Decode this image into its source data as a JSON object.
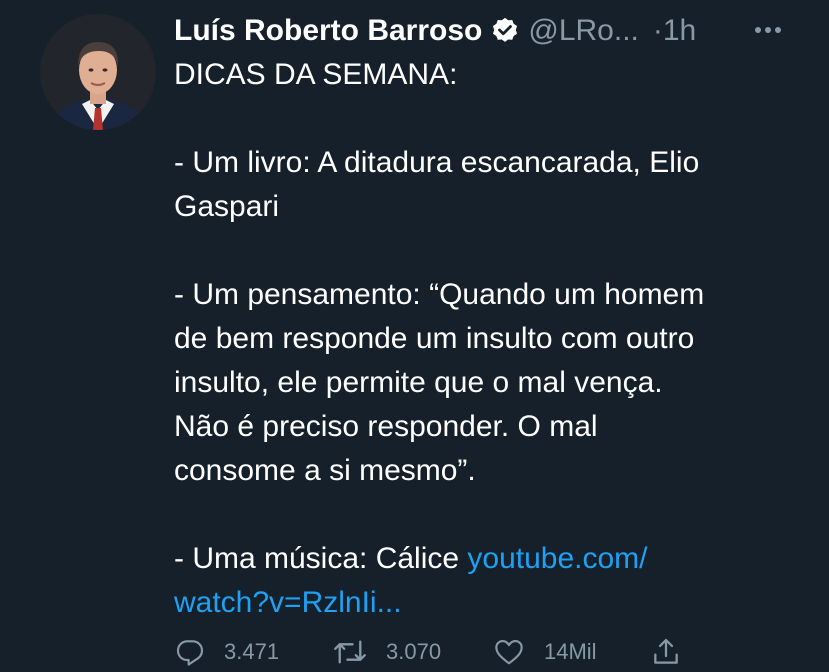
{
  "tweet": {
    "author_name": "Luís Roberto Barroso",
    "handle": "@LRo...",
    "time": "·1h",
    "verified_icon": "verified-badge-icon",
    "more_icon": "more-dots-icon",
    "lines": {
      "l1": "DICAS DA SEMANA:",
      "l2": "- Um livro: A ditadura escancarada, Elio",
      "l3": "Gaspari",
      "l4": "- Um pensamento: “Quando um homem",
      "l5": "de bem responde um insulto com outro",
      "l6": "insulto, ele permite que o mal vença.",
      "l7": "Não é preciso responder. O mal",
      "l8": "consome a si mesmo”.",
      "l9_text": "- Uma música: Cálice ",
      "l9_link": "youtube.com/",
      "l10_link": "watch?v=RzlnIi..."
    }
  },
  "actions": {
    "reply_count": "3.471",
    "retweet_count": "3.070",
    "like_count": "14Mil"
  },
  "colors": {
    "background": "#15202b",
    "link": "#1da1f2",
    "muted": "#8899a6"
  }
}
